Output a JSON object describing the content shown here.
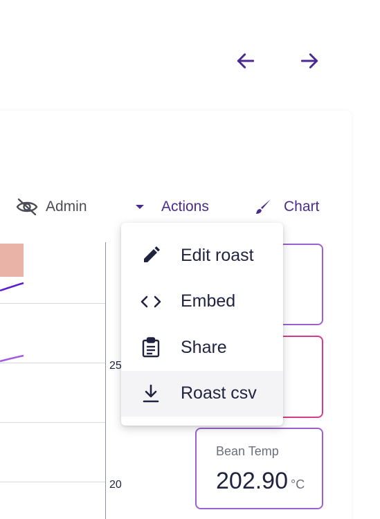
{
  "nav": {
    "back_icon": "arrow-left-icon",
    "forward_icon": "arrow-right-icon",
    "accent": "#4b2a8f"
  },
  "toolbar": {
    "admin_label": "Admin",
    "actions_label": "Actions",
    "chart_label": "Chart"
  },
  "menu": {
    "items": [
      {
        "label": "Edit roast",
        "icon": "pencil-icon"
      },
      {
        "label": "Embed",
        "icon": "code-icon"
      },
      {
        "label": "Share",
        "icon": "clipboard-icon"
      },
      {
        "label": "Roast csv",
        "icon": "download-icon",
        "highlighted": true
      }
    ]
  },
  "chart": {
    "tick_labels": [
      "25",
      "20"
    ]
  },
  "cards": [
    {
      "label": "",
      "value": "",
      "unit": "",
      "border": "#9a5fd1"
    },
    {
      "label": "",
      "value": "",
      "unit": "",
      "border": "#d63a8c"
    },
    {
      "label": "Bean Temp",
      "value": "202.90",
      "unit": "°C",
      "border": "#9a5fd1"
    }
  ]
}
